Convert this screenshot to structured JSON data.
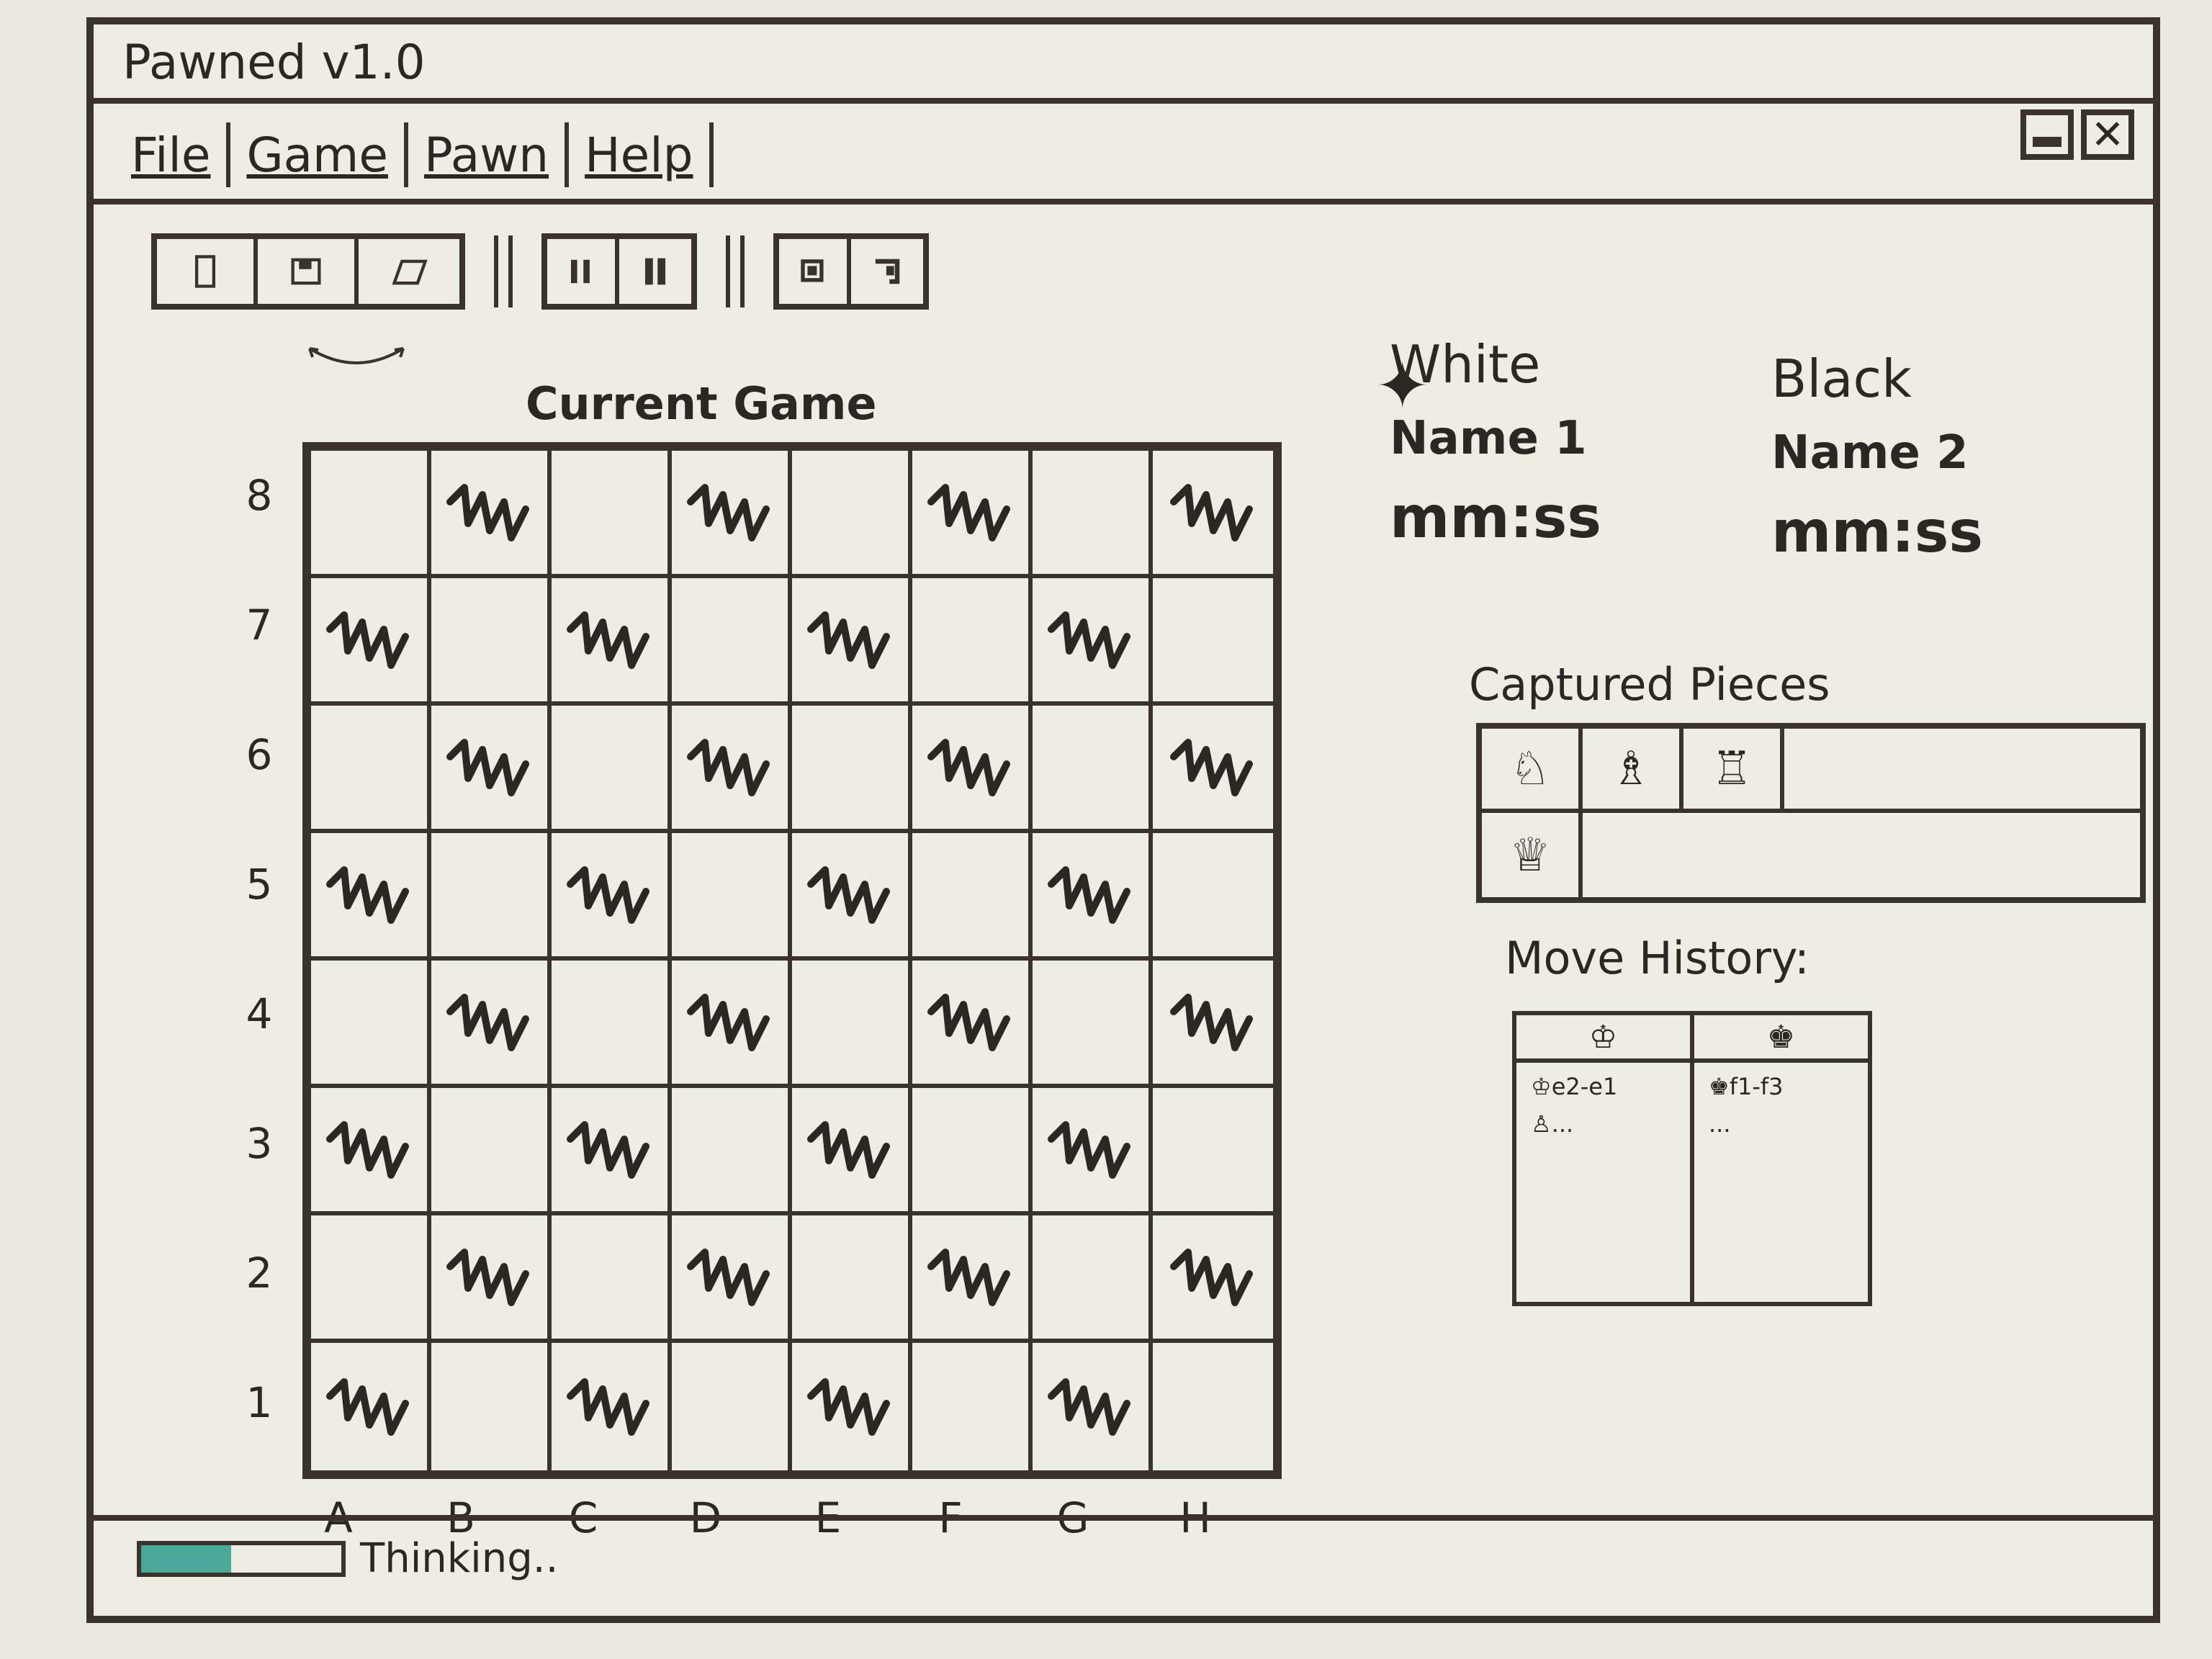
{
  "window": {
    "title": "Pawned v1.0"
  },
  "menu": [
    "File",
    "Game",
    "Pawn",
    "Help"
  ],
  "toolbar": {
    "group1_icons": [
      "new-game-icon",
      "save-game-icon",
      "open-game-icon"
    ],
    "group2_icons": [
      "pause-icon",
      "play-icon"
    ],
    "group3_icons": [
      "undo-icon",
      "redo-icon"
    ]
  },
  "board": {
    "title": "Current Game",
    "ranks": [
      "8",
      "7",
      "6",
      "5",
      "4",
      "3",
      "2",
      "1"
    ],
    "files": [
      "A",
      "B",
      "C",
      "D",
      "E",
      "F",
      "G",
      "H"
    ]
  },
  "players": {
    "white": {
      "side": "White",
      "name": "Name 1",
      "clock": "mm:ss"
    },
    "black": {
      "side": "Black",
      "name": "Name 2",
      "clock": "mm:ss"
    }
  },
  "captured": {
    "title": "Captured Pieces",
    "row1": [
      "♘",
      "♗",
      "♖"
    ],
    "row2": [
      "♕"
    ]
  },
  "history": {
    "title": "Move History:",
    "white_head": "♔",
    "black_head": "♚",
    "white_moves": [
      "♔e2-e1",
      "♙..."
    ],
    "black_moves": [
      "♚f1-f3",
      "..."
    ]
  },
  "status": {
    "progress": 0.45,
    "text": "Thinking.."
  },
  "colors": {
    "ink": "#3a332c",
    "progress_fill": "#4aa89a",
    "board_bg": "#ededE4"
  }
}
